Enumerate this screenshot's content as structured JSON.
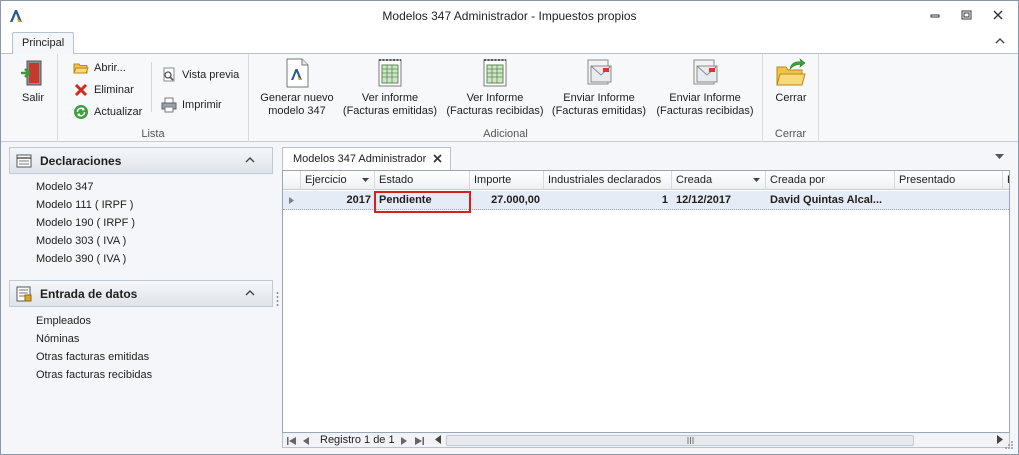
{
  "window": {
    "title": "Modelos 347 Administrador - Impuestos propios"
  },
  "ribbon": {
    "tab_principal": "Principal",
    "groups": {
      "salir": {
        "label": ""
      },
      "lista": {
        "label": "Lista"
      },
      "adicional": {
        "label": "Adicional"
      },
      "cerrar": {
        "label": "Cerrar"
      }
    },
    "buttons": {
      "salir": "Salir",
      "abrir": "Abrir...",
      "eliminar": "Eliminar",
      "actualizar": "Actualizar",
      "vista_previa": "Vista previa",
      "imprimir": "Imprimir",
      "generar_line1": "Generar nuevo",
      "generar_line2": "modelo 347",
      "ver_emitidas_line1": "Ver informe",
      "ver_emitidas_line2": "(Facturas emitidas)",
      "ver_recibidas_line1": "Ver Informe",
      "ver_recibidas_line2": "(Facturas recibidas)",
      "enviar_emitidas_line1": "Enviar Informe",
      "enviar_emitidas_line2": "(Facturas emitidas)",
      "enviar_recibidas_line1": "Enviar Informe",
      "enviar_recibidas_line2": "(Facturas recibidas)",
      "cerrar": "Cerrar"
    }
  },
  "nav": {
    "declaraciones": {
      "title": "Declaraciones",
      "items": [
        "Modelo 347",
        "Modelo 111 ( IRPF )",
        "Modelo 190 ( IRPF )",
        "Modelo 303 ( IVA )",
        "Modelo 390 ( IVA )"
      ]
    },
    "entrada": {
      "title": "Entrada de datos",
      "items": [
        "Empleados",
        "Nóminas",
        "Otras facturas emitidas",
        "Otras facturas recibidas"
      ]
    }
  },
  "document": {
    "tab_title": "Modelos 347 Administrador",
    "columns": [
      "Ejercicio",
      "Estado",
      "Importe",
      "Industriales declarados",
      "Creada",
      "Creada por",
      "Presentado",
      "F"
    ],
    "rows": [
      {
        "ejercicio": "2017",
        "estado": "Pendiente",
        "importe": "27.000,00",
        "industriales": "1",
        "creada": "12/12/2017",
        "creada_por": "David Quintas Alcal...",
        "presentado": ""
      }
    ],
    "record_info": "Registro 1 de 1"
  },
  "colors": {
    "accent": "#2b5797",
    "focus_border": "#d32020",
    "selected_row": "#e5ecf6"
  }
}
